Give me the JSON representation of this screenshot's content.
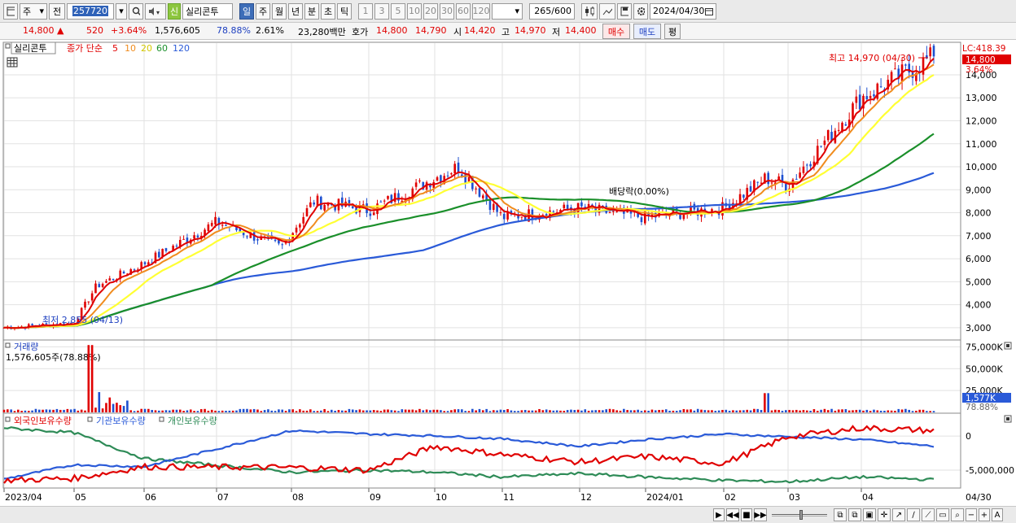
{
  "toolbar": {
    "period_select": "주",
    "prev_label": "전",
    "stock_code": "257720",
    "market_badge": "신",
    "stock_name": "실리콘투",
    "periods": [
      "일",
      "주",
      "월",
      "년",
      "분",
      "초",
      "틱"
    ],
    "active_period": "일",
    "intervals": [
      "1",
      "3",
      "5",
      "10",
      "20",
      "30",
      "60",
      "120"
    ],
    "count": "265",
    "count_total": "/600",
    "date": "2024/04/30"
  },
  "quote": {
    "price": "14,800",
    "arrow": "▲",
    "change": "520",
    "change_pct": "+3.64%",
    "volume": "1,576,605",
    "vol_ratio": "78.88%",
    "turnover_pct": "2.61%",
    "amount": "23,280백만",
    "ask_label": "호가",
    "ask": "14,800",
    "bid": "14,790",
    "open_label": "시",
    "open": "14,420",
    "high_label": "고",
    "high": "14,970",
    "low_label": "저",
    "low": "14,400",
    "buy_label": "매수",
    "sell_label": "매도",
    "eval_label": "평"
  },
  "legend": {
    "name": "실리콘투",
    "ma_title": "종가 단순",
    "ma_periods": [
      "5",
      "10",
      "20",
      "60",
      "120"
    ]
  },
  "annotations": {
    "max_label": "최고 14,970 (04/30)",
    "min_label": "최저 2,855 (04/13)",
    "dividend_label": "배당락(0.00%)",
    "lc_label": "LC:418.39",
    "last_price_tag": "14,800",
    "last_pct_tag": "3.64%"
  },
  "volume_panel": {
    "title": "거래량",
    "info": "1,576,605주(78.88%)",
    "last_tag": "1,577K",
    "last_pct": "78.88%"
  },
  "holdings_panel": {
    "foreign_label": "외국인보유수량",
    "inst_label": "기관보유수량",
    "indiv_label": "개인보유수량"
  },
  "colors": {
    "up": "#e00000",
    "down": "#1e50d0",
    "ma5": "#e00000",
    "ma10": "#f08c1e",
    "ma20": "#ffff33",
    "ma60": "#1a8f2a",
    "ma120": "#2a5ad8",
    "foreign": "#e00000",
    "inst": "#2a5ad8",
    "indiv": "#2e8b57"
  },
  "chart_data": [
    {
      "type": "candlestick",
      "title": "실리콘투",
      "y_axis_ticks": [
        "14,000",
        "13,000",
        "12,000",
        "11,000",
        "10,000",
        "9,000",
        "8,000",
        "7,000",
        "6,000",
        "5,000",
        "4,000",
        "3,000"
      ],
      "ylim": [
        2500,
        14600
      ],
      "x_axis_ticks": [
        "2023/04",
        "05",
        "06",
        "07",
        "08",
        "09",
        "10",
        "11",
        "12",
        "2024/01",
        "02",
        "03",
        "04"
      ],
      "last_date_label": "04/30",
      "series": [
        {
          "name": "종가",
          "x": [
            "2023/04",
            "2023/05 early",
            "2023/05 mid",
            "2023/06",
            "2023/07",
            "2023/08 mid",
            "2023/08 end",
            "2023/09",
            "2023/10 mid",
            "2023/11",
            "2023/12",
            "2024/01",
            "2024/02",
            "2024/02 end",
            "2024/03",
            "2024/04 mid",
            "2024/04/30"
          ],
          "values": [
            3000,
            3200,
            4800,
            5800,
            7600,
            6500,
            8500,
            8100,
            10000,
            7800,
            8200,
            7800,
            8200,
            9500,
            9200,
            13000,
            14800
          ]
        }
      ]
    },
    {
      "type": "bar",
      "title": "거래량",
      "y_axis_ticks": [
        "75,000K",
        "50,000K",
        "25,000K"
      ],
      "ylim": [
        0,
        80000
      ],
      "x_axis_ticks": [
        "2023/04",
        "05",
        "06",
        "07",
        "08",
        "09",
        "10",
        "11",
        "12",
        "2024/01",
        "02",
        "03",
        "04"
      ],
      "series": [
        {
          "name": "거래량",
          "x": [
            "2023/04",
            "2023/05 spike",
            "2023/06",
            "2023/08",
            "2023/10",
            "2024/02 spike",
            "2024/04/30"
          ],
          "values": [
            3000,
            77000,
            4000,
            3500,
            3000,
            22000,
            1577
          ]
        }
      ]
    },
    {
      "type": "line",
      "title": "보유수량",
      "y_axis_ticks": [
        "0",
        "-5,000,000"
      ],
      "x_axis_ticks": [
        "2023/04",
        "05",
        "06",
        "07",
        "08",
        "09",
        "10",
        "11",
        "12",
        "2024/01",
        "02",
        "03",
        "04"
      ],
      "series": [
        {
          "name": "외국인보유수량",
          "x": [
            "2023/04",
            "2023/05",
            "2023/06",
            "2023/08",
            "2023/09",
            "2023/10",
            "2023/11",
            "2023/12",
            "2024/01",
            "2024/02",
            "2024/03",
            "2024/04",
            "2024/04/30"
          ],
          "values": [
            -6500000,
            -6200000,
            -4500000,
            -4600000,
            -5000000,
            -1500000,
            -2700000,
            -3800000,
            -3000000,
            -4000000,
            -100000,
            1200000,
            800000
          ]
        },
        {
          "name": "기관보유수량",
          "x": [
            "2023/04",
            "2023/05",
            "2023/06",
            "2023/08",
            "2023/09",
            "2023/10",
            "2023/11",
            "2023/12",
            "2024/01",
            "2024/02",
            "2024/03",
            "2024/04",
            "2024/04/30"
          ],
          "values": [
            -6300000,
            -4200000,
            -4500000,
            800000,
            300000,
            50000,
            -400000,
            -1500000,
            -500000,
            300000,
            -100000,
            -500000,
            -1500000
          ]
        },
        {
          "name": "개인보유수량",
          "x": [
            "2023/04",
            "2023/05",
            "2023/06",
            "2023/08",
            "2023/09",
            "2023/10",
            "2023/11",
            "2023/12",
            "2024/01",
            "2024/02",
            "2024/03",
            "2024/04",
            "2024/04/30"
          ],
          "values": [
            1200000,
            500000,
            -3300000,
            -5300000,
            -5000000,
            -5300000,
            -6000000,
            -5500000,
            -6000000,
            -6500000,
            -6700000,
            -6000000,
            -6400000
          ]
        }
      ]
    }
  ]
}
